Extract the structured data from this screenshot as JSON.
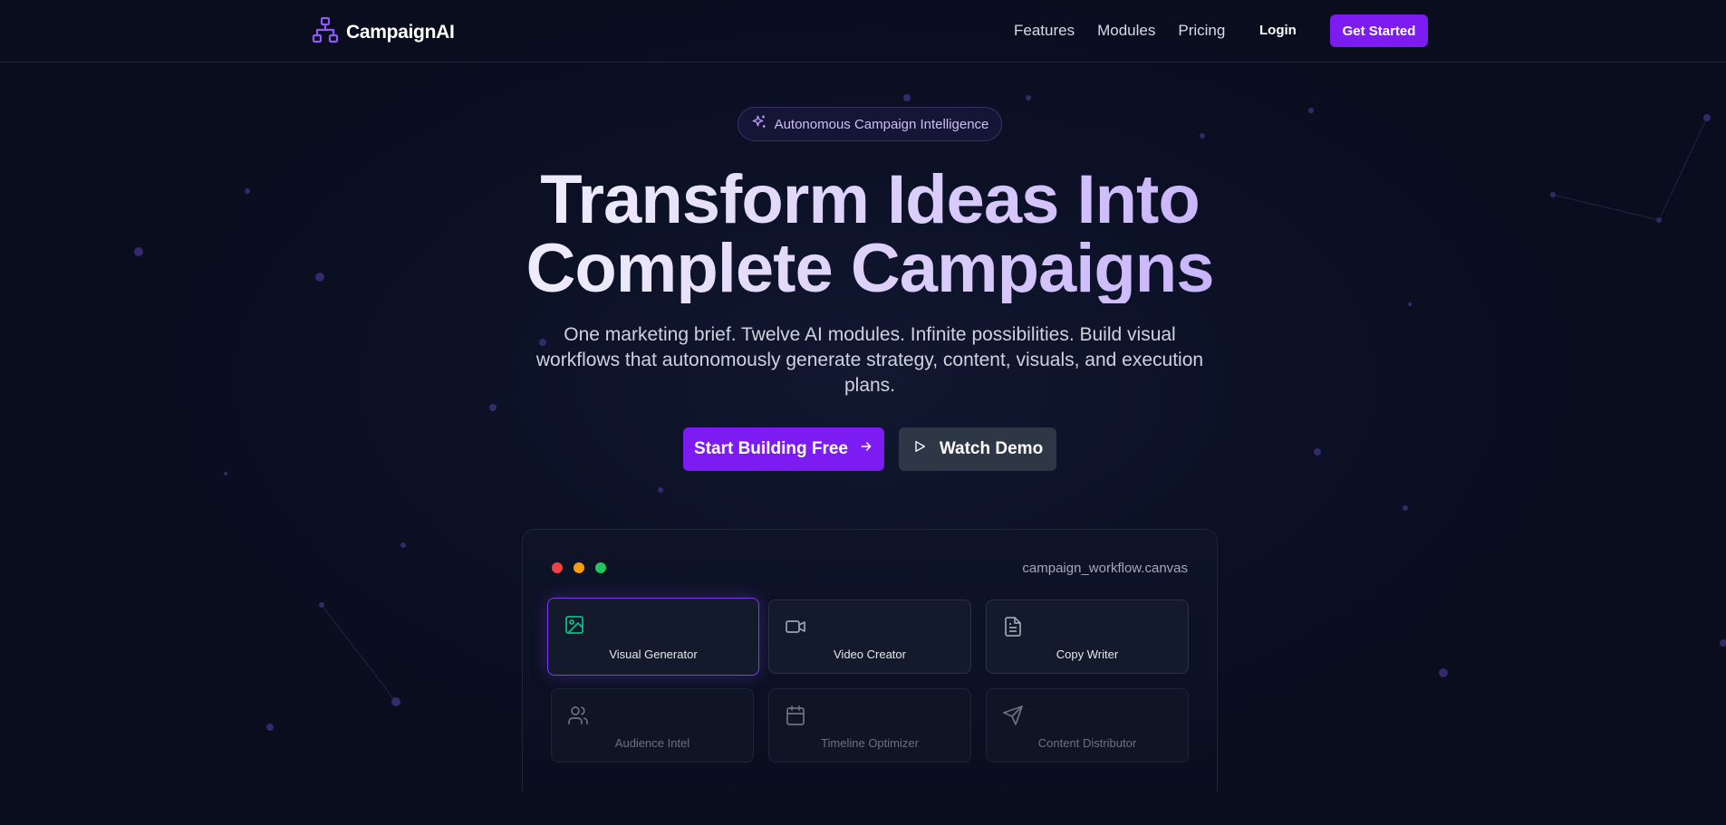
{
  "nav": {
    "brand": "CampaignAI",
    "links": [
      "Features",
      "Modules",
      "Pricing"
    ],
    "login": "Login",
    "get_started": "Get Started"
  },
  "hero": {
    "badge": "Autonomous Campaign Intelligence",
    "headline_line1": "Transform Ideas Into",
    "headline_line2": "Complete Campaigns",
    "subtext": "One marketing brief. Twelve AI modules. Infinite possibilities. Build visual workflows that autonomously generate strategy, content, visuals, and execution plans.",
    "primary_cta": "Start Building Free",
    "secondary_cta": "Watch Demo"
  },
  "canvas": {
    "title": "campaign_workflow.canvas",
    "window_dot_colors": [
      "#ef4444",
      "#f59e0b",
      "#22c55e"
    ],
    "modules": [
      {
        "label": "Visual Generator",
        "icon": "image-icon",
        "state": "active"
      },
      {
        "label": "Video Creator",
        "icon": "video-icon",
        "state": "normal"
      },
      {
        "label": "Copy Writer",
        "icon": "document-icon",
        "state": "normal"
      },
      {
        "label": "Audience Intel",
        "icon": "users-icon",
        "state": "dim"
      },
      {
        "label": "Timeline Optimizer",
        "icon": "calendar-icon",
        "state": "dim"
      },
      {
        "label": "Content Distributor",
        "icon": "send-icon",
        "state": "dim"
      }
    ]
  },
  "colors": {
    "accent": "#7c1cf2",
    "background": "#0a0e1f",
    "secondary_button": "#2e3746",
    "visual_icon": "#10b981"
  }
}
